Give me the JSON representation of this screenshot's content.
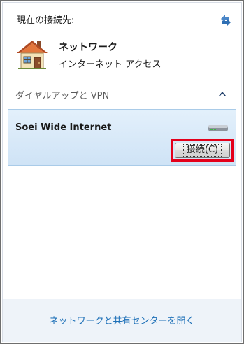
{
  "header": {
    "current_label": "現在の接続先:",
    "refresh_icon": "refresh-icon"
  },
  "current_network": {
    "name": "ネットワーク",
    "status": "インターネット アクセス",
    "icon": "house-icon"
  },
  "dialup_section": {
    "title": "ダイヤルアップと VPN",
    "collapse_icon": "chevron-up-icon"
  },
  "connection": {
    "name": "Soei Wide Internet",
    "icon": "modem-icon",
    "connect_label": "接続(C)",
    "highlight_color": "#e4001b"
  },
  "footer": {
    "link_text": "ネットワークと共有センターを開く",
    "link_color": "#1c6fb7"
  }
}
